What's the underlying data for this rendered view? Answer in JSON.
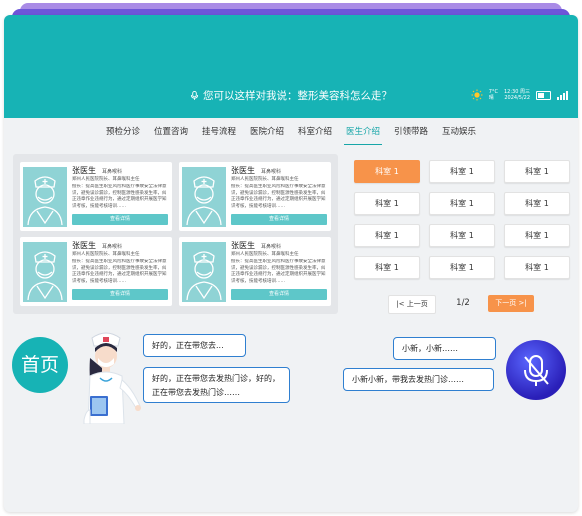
{
  "header": {
    "prompt": "您可以这样对我说：整形美容科怎么走？",
    "weather_temp": "7°C",
    "weather_desc": "晴",
    "time": "12:30",
    "weekday": "周三",
    "date": "2024/5/22"
  },
  "nav": {
    "tabs": [
      "预检分诊",
      "位置咨询",
      "挂号流程",
      "医院介绍",
      "科室介绍",
      "医生介绍",
      "引领带路",
      "互动娱乐"
    ],
    "active_index": 5
  },
  "doctors": [
    {
      "name": "张医生",
      "dept": "耳鼻喉科",
      "title": "郑州人民医院院长、耳鼻喉科主任",
      "desc": "擅长：提高医生职业风险和医疗事故安全法律意识，避免误诊漏诊，控制医源性感染发生率，纠正违章作业违规行为，通过定期组织开展医学知识考核，技能考核培训……",
      "button": "查看详情"
    },
    {
      "name": "张医生",
      "dept": "耳鼻喉科",
      "title": "郑州人民医院院长、耳鼻喉科主任",
      "desc": "擅长：提高医生职业风险和医疗事故安全法律意识，避免误诊漏诊，控制医源性感染发生率，纠正违章作业违规行为，通过定期组织开展医学知识考核，技能考核培训……",
      "button": "查看详情"
    },
    {
      "name": "张医生",
      "dept": "耳鼻喉科",
      "title": "郑州人民医院院长、耳鼻喉科主任",
      "desc": "擅长：提高医生职业风险和医疗事故安全法律意识，避免误诊漏诊，控制医源性感染发生率，纠正违章作业违规行为，通过定期组织开展医学知识考核，技能考核培训……",
      "button": "查看详情"
    },
    {
      "name": "张医生",
      "dept": "耳鼻喉科",
      "title": "郑州人民医院院长、耳鼻喉科主任",
      "desc": "擅长：提高医生职业风险和医疗事故安全法律意识，避免误诊漏诊，控制医源性感染发生率，纠正违章作业违规行为，通过定期组织开展医学知识考核，技能考核培训……",
      "button": "查看详情"
    }
  ],
  "rooms": [
    "科室 1",
    "科室 1",
    "科室 1",
    "科室 1",
    "科室 1",
    "科室 1",
    "科室 1",
    "科室 1",
    "科室 1",
    "科室 1",
    "科室 1",
    "科室 1"
  ],
  "active_room": 0,
  "pager": {
    "prev": "|< 上一页",
    "page": "1/2",
    "next": "下一页 >|"
  },
  "home_label": "首页",
  "dialog": {
    "robot_1": "好的，正在带您去...",
    "robot_2": "好的，正在带您去发热门诊，好的，正在带您去发热门诊……",
    "user_1": "小新，小新……",
    "user_2": "小新小新，带我去发热门诊……"
  },
  "colors": {
    "brand": "#17b3b5",
    "accent": "#f7934a",
    "bubble_border": "#2f7fd0"
  },
  "icons": {
    "mic": "mic-icon",
    "voice_off": "mic-off-icon",
    "weather": "sun-icon"
  }
}
